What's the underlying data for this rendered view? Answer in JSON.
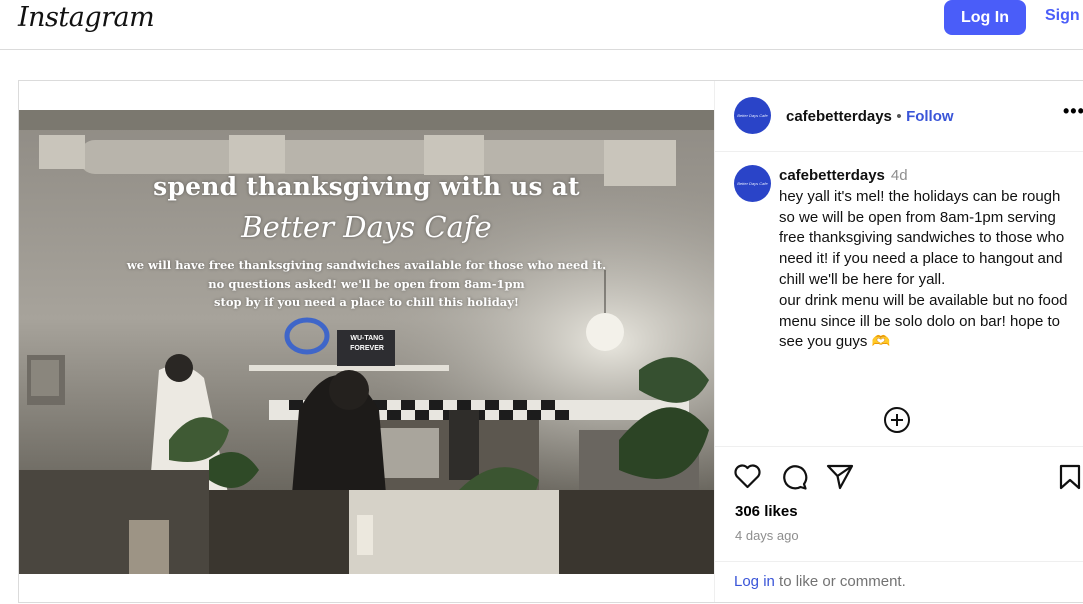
{
  "header": {
    "logo": "Instagram",
    "login_label": "Log In",
    "signup_label": "Sign"
  },
  "post": {
    "username": "cafebetterdays",
    "follow_label": "Follow",
    "separator": "•",
    "avatar_text": "Better Days Cafe",
    "image_text": {
      "heading": "spend thanksgiving with us at",
      "brand": "Better Days Cafe",
      "lines": [
        "we will have free thanksgiving sandwiches available for those who need it.",
        "no questions asked! we'll be open from 8am-1pm",
        "stop by if you need a place to chill this holiday!"
      ],
      "sign": "WU-TANG FOREVER"
    },
    "caption": {
      "age": "4d",
      "text": "hey yall it's mel! the holidays can be rough so we will be open from 8am-1pm serving free thanksgiving sandwiches to those who need it! if you need a place to hangout and chill we'll be here for yall.\nour drink menu will be available but no food menu since ill be solo dolo on bar! hope to see you guys 🫶"
    },
    "likes": "306 likes",
    "time": "4 days ago",
    "login_prompt": {
      "link": "Log in",
      "rest": " to like or comment."
    },
    "icons": [
      "heart-icon",
      "comment-icon",
      "share-icon",
      "bookmark-icon",
      "more-icon",
      "add-icon"
    ],
    "colors": {
      "accent": "#4a5df9",
      "link": "#3a55d8",
      "avatar": "#2a44c8"
    }
  }
}
